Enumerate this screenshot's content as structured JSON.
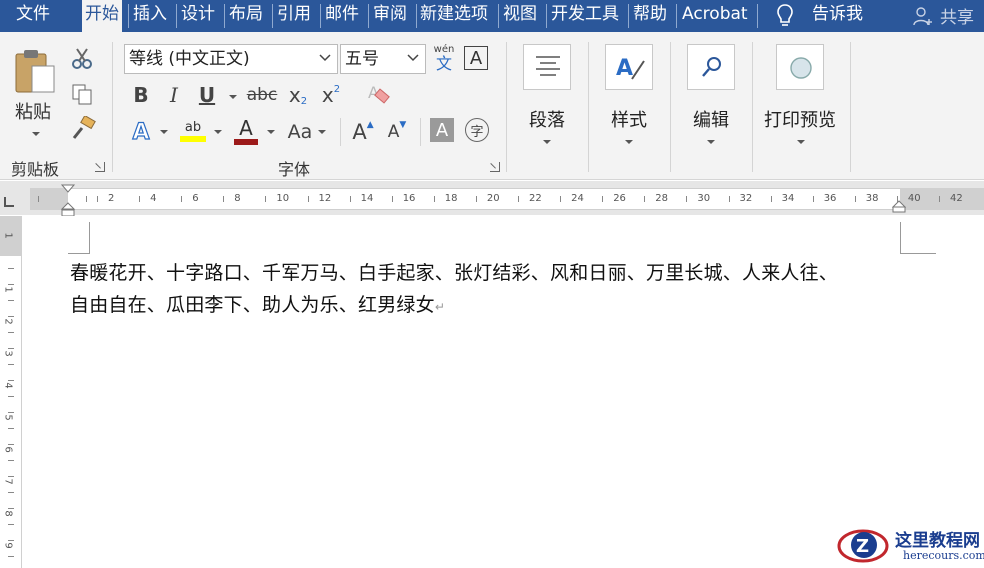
{
  "tabs": [
    {
      "label": "文件"
    },
    {
      "label": "开始"
    },
    {
      "label": "插入"
    },
    {
      "label": "设计"
    },
    {
      "label": "布局"
    },
    {
      "label": "引用"
    },
    {
      "label": "邮件"
    },
    {
      "label": "审阅"
    },
    {
      "label": "新建选项"
    },
    {
      "label": "视图"
    },
    {
      "label": "开发工具"
    },
    {
      "label": "帮助"
    },
    {
      "label": "Acrobat"
    }
  ],
  "tell_me": "告诉我",
  "share": "共享",
  "clipboard": {
    "paste_label": "粘贴",
    "group_label": "剪贴板"
  },
  "font": {
    "name": "等线 (中文正文)",
    "size": "五号",
    "group_label": "字体",
    "phonetic_top": "wén",
    "phonetic_bottom": "文",
    "border_char": "A",
    "bold": "B",
    "italic": "I",
    "underline": "U",
    "strike": "abc",
    "subscript": "x",
    "superscript": "x",
    "grow": "A",
    "shrink": "A",
    "shade": "A",
    "enclose": "字",
    "effects": "A",
    "highlight": "ab",
    "color_char": "A",
    "case": "Aa",
    "highlight_color": "#ffff00",
    "font_color": "#c00000"
  },
  "paragraph": {
    "label": "段落"
  },
  "styles": {
    "label": "样式"
  },
  "editing": {
    "label": "编辑"
  },
  "print_preview": {
    "label": "打印预览"
  },
  "ruler": {
    "numbers": [
      "2",
      "4",
      "6",
      "8",
      "10",
      "12",
      "14",
      "16",
      "18",
      "20",
      "22",
      "24",
      "26",
      "28",
      "30",
      "32",
      "34",
      "36",
      "38",
      "40",
      "42"
    ],
    "vnumbers": [
      "1",
      "1",
      "2",
      "3",
      "4",
      "5",
      "6",
      "7",
      "8",
      "9"
    ]
  },
  "document": {
    "line1": "春暖花开、十字路口、千军万马、白手起家、张灯结彩、风和日丽、万里长城、人来人往、",
    "line2": "自由自在、瓜田李下、助人为乐、红男绿女",
    "para_mark": "↵"
  },
  "watermark": {
    "title": "这里教程网",
    "url": "herecours.com"
  },
  "colors": {
    "accent": "#2b579a"
  }
}
